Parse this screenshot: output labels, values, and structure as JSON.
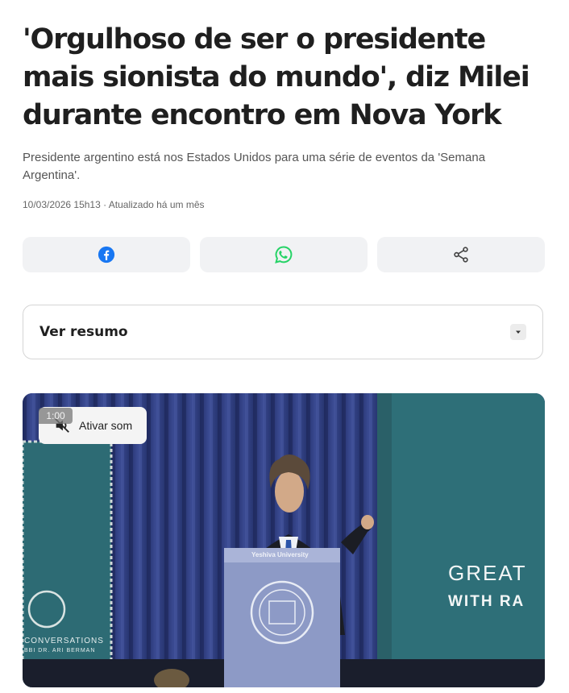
{
  "article": {
    "headline": "'Orgulhoso de ser o presidente mais sionista do mundo', diz Milei durante encontro em Nova York",
    "subtitle": "Presidente argentino está nos Estados Unidos para uma série de eventos da 'Semana Argentina'.",
    "date": "10/03/2026 15h13 · Atualizado há um mês"
  },
  "share": {
    "facebook_icon": "facebook-icon",
    "whatsapp_icon": "whatsapp-icon",
    "share_icon": "share-icon",
    "facebook_color": "#1877f2",
    "whatsapp_color": "#25d366"
  },
  "summary": {
    "label": "Ver resumo",
    "icon": "chevron-down-icon"
  },
  "video": {
    "mute_label": "Ativar som",
    "mute_icon": "speaker-muted-icon",
    "timer": "1:00",
    "podium_label": "Yeshiva University",
    "banner_line1": "GREAT",
    "banner_line2": "WITH RA",
    "left_banner_line1": "CONVERSATIONS",
    "left_banner_line2": "BBI DR. ARI BERMAN"
  }
}
